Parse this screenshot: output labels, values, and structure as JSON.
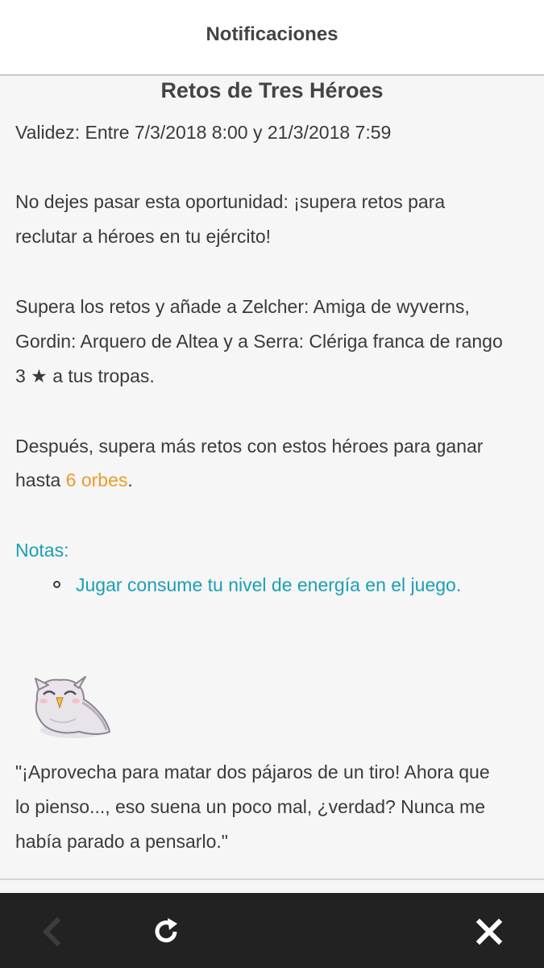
{
  "header": {
    "title": "Notificaciones"
  },
  "article": {
    "title": "Retos de Tres Héroes",
    "validity": "Validez: Entre 7/3/2018 8:00 y 21/3/2018 7:59",
    "p1_line1": "No dejes pasar esta oportunidad: ¡supera retos para",
    "p1_line2": "reclutar a héroes en tu ejército!",
    "p2_line1": "Supera los retos y añade a Zelcher: Amiga de wyverns,",
    "p2_line2": "Gordin: Arquero de Altea y a Serra: Clériga franca de rango",
    "p2_line3": "3 ★ a tus tropas.",
    "p3_line1": "Después, supera más retos con estos héroes para ganar",
    "p3_line2_prefix": "hasta ",
    "p3_line2_highlight": "6 orbes",
    "p3_line2_suffix": ".",
    "notes_label": "Notas:",
    "note_item": "Jugar consume tu nivel de energía en el juego.",
    "quote_line1": "\"¡Aprovecha para matar dos pájaros de un tiro! Ahora que",
    "quote_line2": "lo pienso..., eso suena un poco mal, ¿verdad? Nunca me",
    "quote_line3": "había parado a pensarlo.\""
  },
  "icons": {
    "back": "back-arrow-icon",
    "refresh": "refresh-icon",
    "close": "close-icon",
    "mascot": "owl-mascot-icon"
  },
  "colors": {
    "highlight_orange": "#ed9b2b",
    "notes_teal": "#1b9fb7",
    "bottom_bar": "#222222"
  }
}
